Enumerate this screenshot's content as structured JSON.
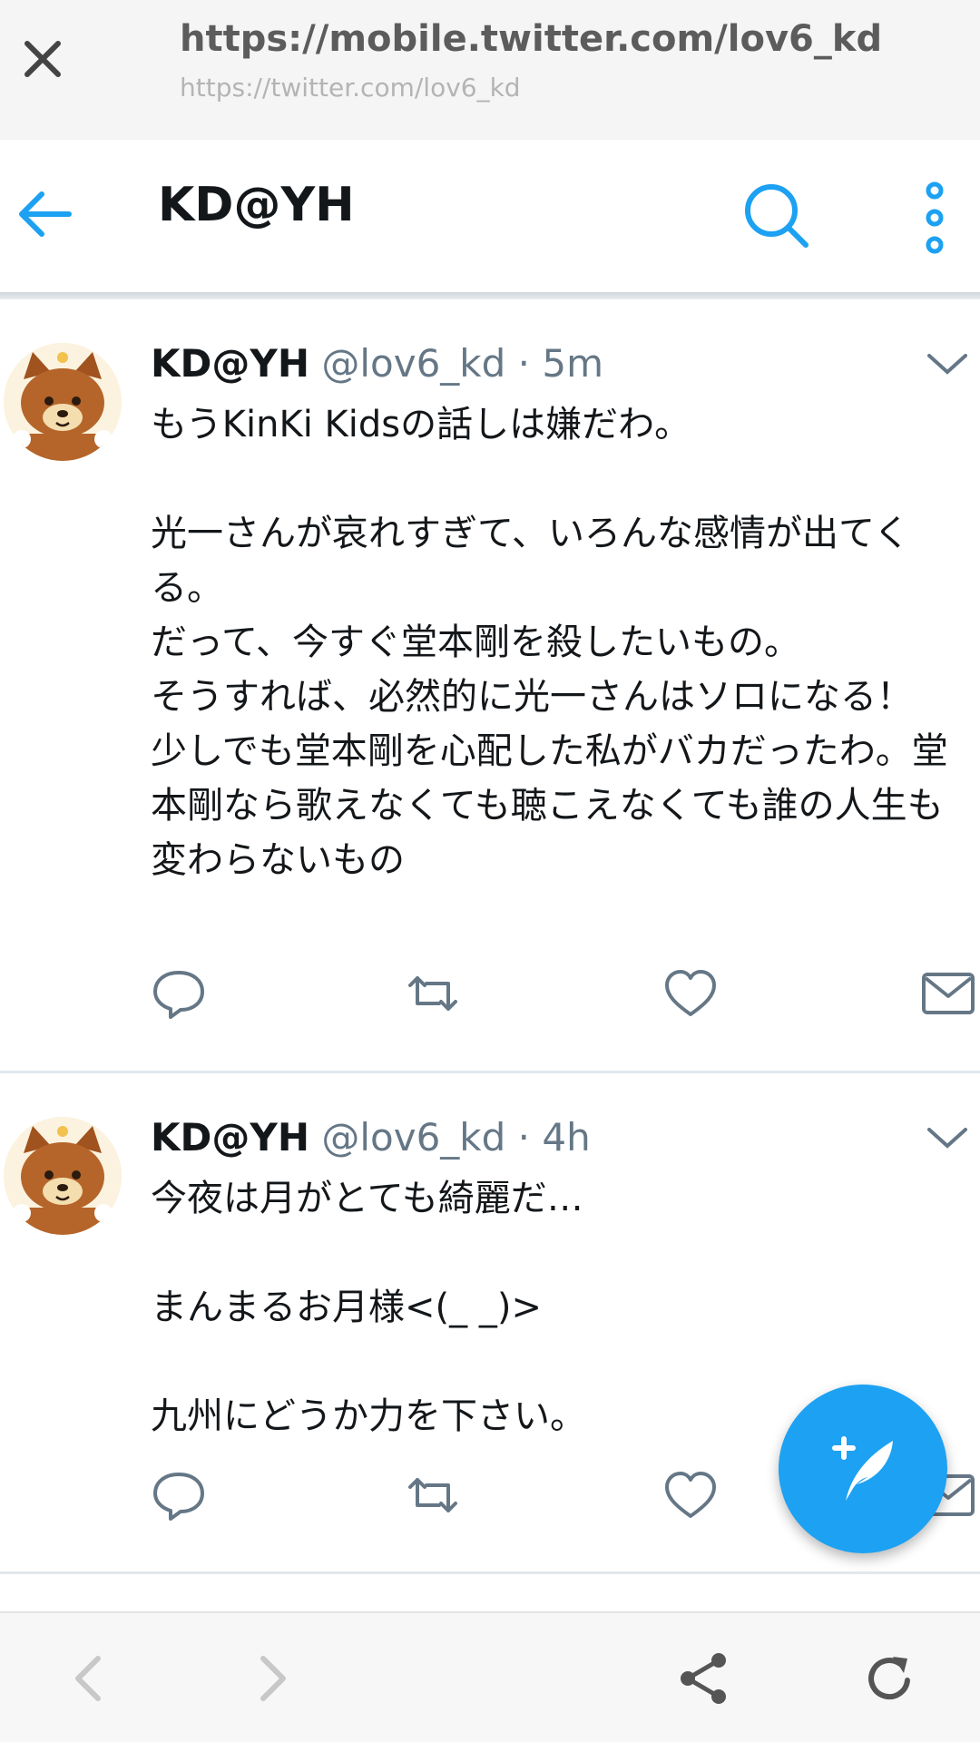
{
  "browser": {
    "url": "https://mobile.twitter.com/lov6_kd",
    "sub_url": "https://twitter.com/lov6_kd"
  },
  "header": {
    "title": "KD@YH"
  },
  "tweets": [
    {
      "name": "KD@YH",
      "handle": "@lov6_kd",
      "separator": "·",
      "time": "5m",
      "text": "もうKinKi Kidsの話しは嫌だわ。\n\n光一さんが哀れすぎて、いろんな感情が出てくる。\nだって、今すぐ堂本剛を殺したいもの。\nそうすれば、必然的に光一さんはソロになる！\n少しでも堂本剛を心配した私がバカだったわ。堂本剛なら歌えなくても聴こえなくても誰の人生も変わらないもの"
    },
    {
      "name": "KD@YH",
      "handle": "@lov6_kd",
      "separator": "·",
      "time": "4h",
      "text": "今夜は月がとても綺麗だ…\n\nまんまるお月様<(_ _)>\n\n九州にどうか力を下さい。"
    }
  ],
  "icons": {
    "close": "close-icon",
    "back": "back-arrow-icon",
    "search": "search-icon",
    "more": "more-vertical-icon",
    "reply": "reply-icon",
    "retweet": "retweet-icon",
    "like": "heart-icon",
    "dm": "mail-icon",
    "compose": "compose-tweet-icon",
    "share": "share-icon",
    "reload": "reload-icon"
  },
  "colors": {
    "accent": "#1da1f2",
    "text": "#14171a",
    "secondary": "#657786"
  }
}
